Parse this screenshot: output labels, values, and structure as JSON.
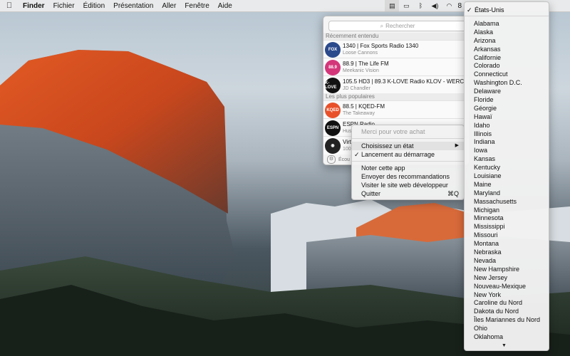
{
  "menubar": {
    "apple_icon": "apple-logo-icon",
    "items": [
      "Finder",
      "Fichier",
      "Édition",
      "Présentation",
      "Aller",
      "Fenêtre",
      "Aide"
    ],
    "status_icons": [
      "radio-app-icon",
      "airplay-icon",
      "bluetooth-icon",
      "volume-icon",
      "wifi-icon"
    ],
    "status_text": "8"
  },
  "popover": {
    "search_placeholder": "Rechercher",
    "recent_label": "Récemment entendu",
    "popular_label": "Les plus populaires",
    "recent": [
      {
        "title": "1340 | Fox Sports Radio 1340",
        "subtitle": "Loose Cannons",
        "logo": "FOX",
        "color": "#2b4a8c"
      },
      {
        "title": "88.9 | The Life FM",
        "subtitle": "Meekanic Vision",
        "logo": "88.9",
        "color": "#d4367a"
      },
      {
        "title": "105.5 HD3 | 89.3 K-LOVE Radio KLOV - WERC-",
        "subtitle": "JD Chandler",
        "logo": "K-LOVE",
        "color": "#111111"
      }
    ],
    "popular": [
      {
        "title": "88.5 | KQED-FM",
        "subtitle": "The Takeaway",
        "logo": "KQED",
        "color": "#e8502a"
      },
      {
        "title": "ESPN Radio",
        "subtitle": "Hus",
        "logo": "ESPN",
        "color": "#111111"
      },
      {
        "title": "Virt",
        "subtitle": "100",
        "logo": "◉",
        "color": "#222222"
      }
    ],
    "listen_label": "Écou"
  },
  "context_menu": {
    "thanks": "Merci pour votre achat",
    "choose_state": "Choisissez un état",
    "launch_at_login": "Lancement au démarrage",
    "rate_app": "Noter cette app",
    "send_recommendations": "Envoyer des recommandations",
    "visit_website": "Visiter le site web développeur",
    "quit": "Quitter",
    "quit_shortcut": "⌘Q"
  },
  "states_menu": {
    "selected": "États-Unis",
    "items": [
      "Alabama",
      "Alaska",
      "Arizona",
      "Arkansas",
      "Californie",
      "Colorado",
      "Connecticut",
      "Washington D.C.",
      "Delaware",
      "Floride",
      "Géorgie",
      "Hawaï",
      "Idaho",
      "Illinois",
      "Indiana",
      "Iowa",
      "Kansas",
      "Kentucky",
      "Louisiane",
      "Maine",
      "Maryland",
      "Massachusetts",
      "Michigan",
      "Minnesota",
      "Mississippi",
      "Missouri",
      "Montana",
      "Nebraska",
      "Nevada",
      "New Hampshire",
      "New Jersey",
      "Nouveau-Mexique",
      "New York",
      "Caroline du Nord",
      "Dakota du Nord",
      "Îles Mariannes du Nord",
      "Ohio",
      "Oklahoma"
    ]
  }
}
